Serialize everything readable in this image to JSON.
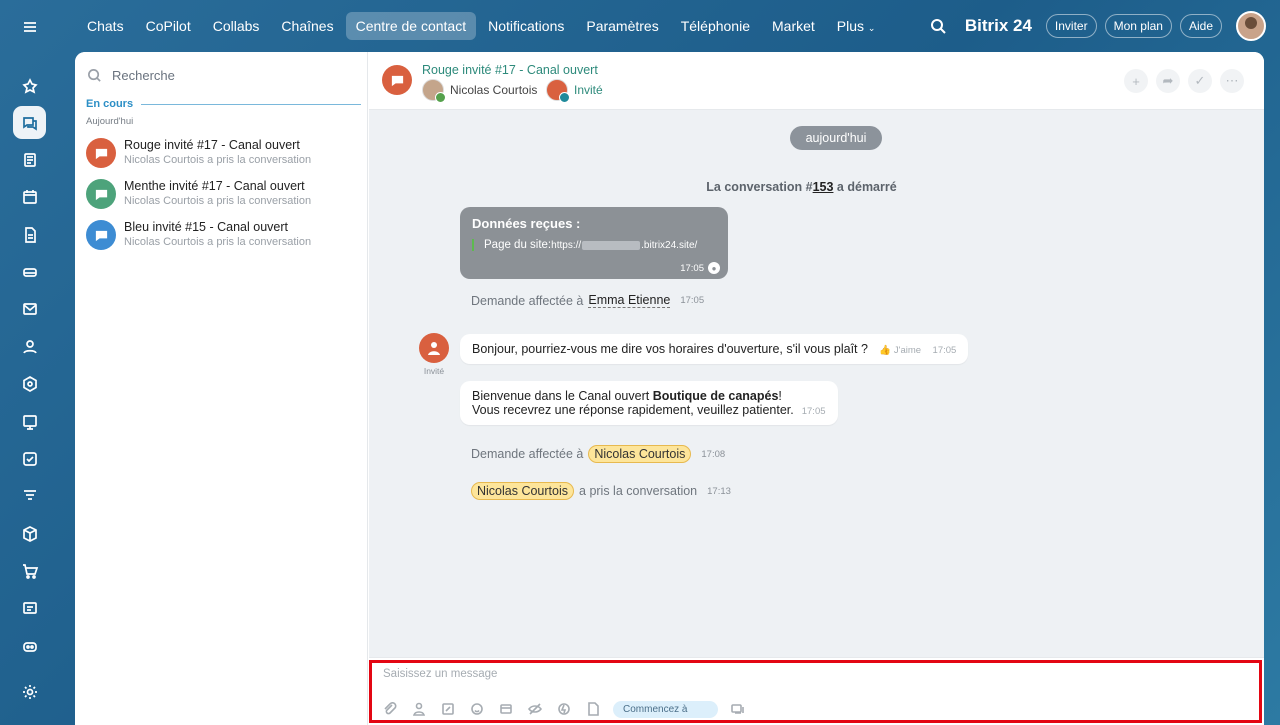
{
  "nav": {
    "tabs": [
      "Chats",
      "CoPilot",
      "Collabs",
      "Chaînes",
      "Centre de contact",
      "Notifications",
      "Paramètres",
      "Téléphonie",
      "Market",
      "Plus"
    ],
    "logo": "Bitrix 24",
    "invite": "Inviter",
    "plan": "Mon plan",
    "help": "Aide"
  },
  "sidebar": {
    "search_placeholder": "Recherche",
    "section": "En cours",
    "day": "Aujourd'hui",
    "conversations": [
      {
        "title": "Rouge invité #17 - Canal ouvert",
        "subtitle": "Nicolas Courtois a pris la conversation",
        "color": "#d9603f"
      },
      {
        "title": "Menthe invité #17 - Canal ouvert",
        "subtitle": "Nicolas Courtois a pris la conversation",
        "color": "#4da37b"
      },
      {
        "title": "Bleu invité #15 - Canal ouvert",
        "subtitle": "Nicolas Courtois a pris la conversation",
        "color": "#3d8cd3"
      }
    ]
  },
  "chat": {
    "title": "Rouge invité #17 - Canal ouvert",
    "member1": "Nicolas Courtois",
    "member2": "Invité",
    "day": "aujourd'hui",
    "started_prefix": "La conversation #",
    "started_num": "153",
    "started_suffix": " a démarré",
    "data_title": "Données reçues :",
    "data_line_label": "Page du site:",
    "data_line_url_start": "https://",
    "data_line_url_end": ".bitrix24.site/",
    "data_time": "17:05",
    "assign1_text": "Demande affectée à",
    "assign1_name": "Emma Etienne",
    "assign1_time": "17:05",
    "guest_label": "Invité",
    "msg1": "Bonjour, pourriez-vous me dire vos horaires d'ouverture, s'il vous plaît ?",
    "msg1_like": "J'aime",
    "msg1_time": "17:05",
    "msg2_line1_prefix": "Bienvenue dans le Canal ouvert ",
    "msg2_bold": "Boutique de canapés",
    "msg2_line1_suffix": "!",
    "msg2_line2": "Vous recevrez une réponse rapidement, veuillez patienter.",
    "msg2_time": "17:05",
    "assign2_text": "Demande affectée à",
    "assign2_name": "Nicolas Courtois",
    "assign2_time": "17:08",
    "took_name": "Nicolas Courtois",
    "took_text": "a pris la conversation",
    "took_time": "17:13",
    "composer_placeholder": "Saisissez un message",
    "composer_pill": "Commencez à"
  }
}
